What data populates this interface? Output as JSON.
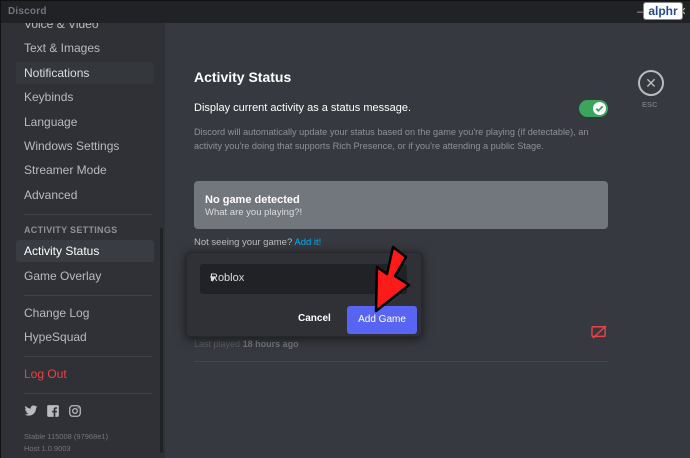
{
  "titlebar": {
    "app_name": "Discord"
  },
  "badge": "alphr",
  "sidebar": {
    "items_top": [
      {
        "label": "Voice & Video"
      },
      {
        "label": "Text & Images"
      },
      {
        "label": "Notifications"
      },
      {
        "label": "Keybinds"
      },
      {
        "label": "Language"
      },
      {
        "label": "Windows Settings"
      },
      {
        "label": "Streamer Mode"
      },
      {
        "label": "Advanced"
      }
    ],
    "activity_header": "ACTIVITY SETTINGS",
    "activity_items": [
      {
        "label": "Activity Status"
      },
      {
        "label": "Game Overlay"
      }
    ],
    "other_items": [
      {
        "label": "Change Log"
      },
      {
        "label": "HypeSquad"
      }
    ],
    "logout": "Log Out",
    "build_stable": "Stable 115008 (97968e1)",
    "build_host": "Host 1.0.9003"
  },
  "content": {
    "title": "Activity Status",
    "toggle_label": "Display current activity as a status message.",
    "toggle_on": true,
    "description": "Discord will automatically update your status based on the game you're playing (if detectable), an activity you're doing that supports Rich Presence, or if you're attending a public Stage.",
    "detect_title": "No game detected",
    "detect_subtitle": "What are you playing?!",
    "not_seeing": "Not seeing your game?",
    "add_it": "Add it!",
    "last_played_prefix": "Last played",
    "last_played_value": "18 hours ago",
    "esc_label": "ESC"
  },
  "popup": {
    "selected_game": "Roblox",
    "cancel_label": "Cancel",
    "add_label": "Add Game"
  },
  "colors": {
    "accent": "#5865f2",
    "toggle_green": "#3ba55c",
    "danger": "#ed4245",
    "link": "#00aff4",
    "arrow_red": "#ff1a1a"
  }
}
